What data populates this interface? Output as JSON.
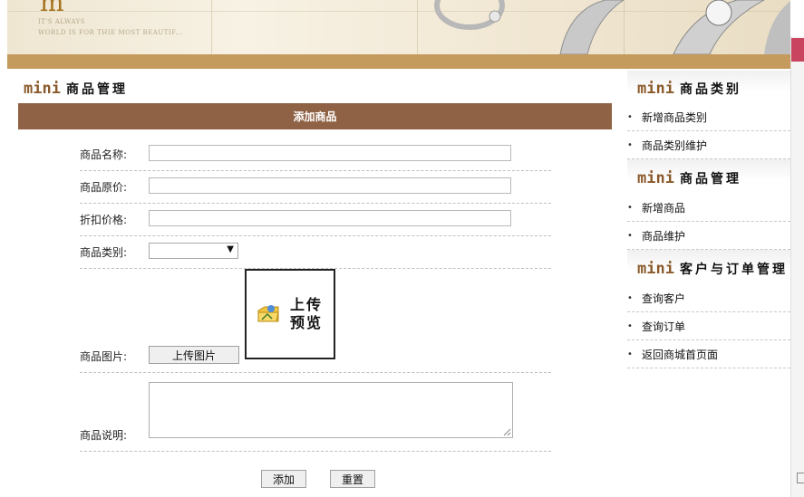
{
  "banner": {
    "logo_mark": "m",
    "tagline_1": "IT'S ALWAYS",
    "tagline_2": "WORLD IS FOR THIE MOST BEAUTIF..."
  },
  "main": {
    "section_mini": "mini",
    "section_title": "商品管理",
    "form_title": "添加商品",
    "fields": {
      "name_label": "商品名称:",
      "original_price_label": "商品原价:",
      "discount_price_label": "折扣价格:",
      "category_label": "商品类别:",
      "category_selected": "",
      "image_label": "商品图片:",
      "upload_button": "上传图片",
      "preview_line1": "上传",
      "preview_line2": "预览",
      "description_label": "商品说明:"
    },
    "buttons": {
      "add": "添加",
      "reset": "重置"
    }
  },
  "sidebar": {
    "sections": [
      {
        "mini": "mini",
        "title": "商品类别",
        "items": [
          "新增商品类别",
          "商品类别维护"
        ]
      },
      {
        "mini": "mini",
        "title": "商品管理",
        "items": [
          "新增商品",
          "商品维护"
        ]
      },
      {
        "mini": "mini",
        "title": "客户与订单管理",
        "items": [
          "查询客户",
          "查询订单",
          "返回商城首页面"
        ]
      }
    ]
  },
  "colors": {
    "accent_brown": "#8f6245",
    "bar_tan": "#c49a5d",
    "mini_brown": "#8b5a2b"
  },
  "icons": [
    "ring-image",
    "upload-preview-icon",
    "resize-grip-icon",
    "select-arrow-icon"
  ]
}
